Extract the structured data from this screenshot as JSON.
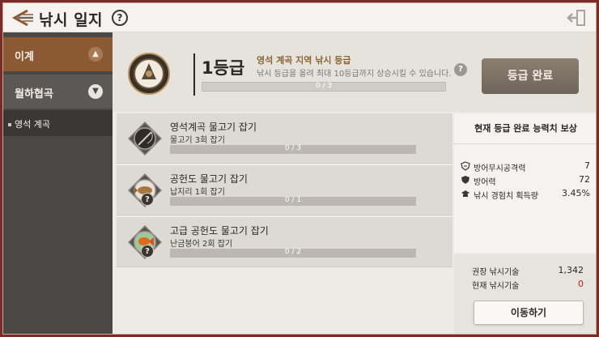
{
  "header": {
    "title": "낚시 일지",
    "help_icon": "question-circle-icon",
    "exit_icon": "exit-door-icon"
  },
  "sidebar": {
    "items": [
      {
        "label": "이계",
        "icon": "chevron-up-icon",
        "state": "active"
      },
      {
        "label": "월하협곡",
        "icon": "chevron-down-icon"
      }
    ],
    "sub_items": [
      {
        "label": "영석 계곡",
        "state": "selected"
      }
    ]
  },
  "grade": {
    "label": "1등급",
    "subtitle": "영석 계곡 지역 낚시 등급",
    "description": "낚시 등급을 올려 최대 10등급까지 상승시킬 수 있습니다.",
    "progress_text": "0 / 3",
    "progress_fraction": 0,
    "complete_button": "등급 완료"
  },
  "missions": [
    {
      "title": "영석계곡 물고기 잡기",
      "subtitle": "물고기 3회 잡기",
      "progress_text": "0 / 3",
      "progress_fraction": 0,
      "icon": "fishing-rod-icon",
      "has_help_badge": false
    },
    {
      "title": "공헌도 물고기 잡기",
      "subtitle": "납지리 1회 잡기",
      "progress_text": "0 / 1",
      "progress_fraction": 0,
      "icon": "flatfish-icon",
      "has_help_badge": true
    },
    {
      "title": "고급 공헌도 물고기 잡기",
      "subtitle": "난금붕어 2회 잡기",
      "progress_text": "0 / 2",
      "progress_fraction": 0,
      "icon": "goldfish-icon",
      "has_help_badge": true
    }
  ],
  "help_badge_label": "?",
  "reward": {
    "title": "현재 등급 완료 능력치 보상",
    "stats": [
      {
        "name": "방어무시공격력",
        "value": "7",
        "icon": "shield-pierce-icon"
      },
      {
        "name": "방어력",
        "value": "72",
        "icon": "shield-icon"
      },
      {
        "name": "낚시 경험치 획득량",
        "value": "3.45%",
        "icon": "graduation-cap-icon"
      }
    ]
  },
  "requirement": {
    "recommended_label": "권장 낚시기술",
    "recommended_value": "1,342",
    "current_label": "현재 낚시기술",
    "current_value": "0",
    "move_button": "이동하기"
  },
  "colors": {
    "accent": "#8b5a34",
    "warning": "#d11515",
    "progress_fill": "#b99360"
  }
}
